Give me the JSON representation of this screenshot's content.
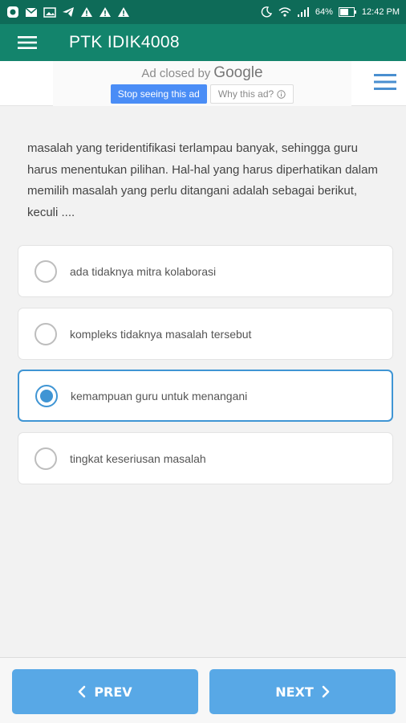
{
  "status_bar": {
    "battery": "64%",
    "time": "12:42 PM",
    "left_icons": [
      "app-icon",
      "mail-icon",
      "image-icon",
      "telegram-icon",
      "warning-icon",
      "warning-icon",
      "warning-icon"
    ],
    "right_icons": [
      "do-not-disturb-icon",
      "wifi-icon",
      "signal-icon",
      "battery-icon"
    ]
  },
  "app_bar": {
    "title": "PTK IDIK4008",
    "color": "#13846c"
  },
  "ad": {
    "closed_by": "Ad closed by",
    "google": "Google",
    "stop_button": "Stop seeing this ad",
    "why_button": "Why this ad?"
  },
  "question": {
    "text": "masalah yang teridentifikasi terlampau banyak, sehingga guru harus menentukan pilihan. Hal-hal yang harus diperhatikan dalam memilih masalah yang perlu ditangani adalah sebagai berikut, keculi ...."
  },
  "options": [
    {
      "label": "ada tidaknya mitra kolaborasi",
      "selected": false
    },
    {
      "label": "kompleks tidaknya masalah tersebut",
      "selected": false
    },
    {
      "label": "kemampuan guru untuk menangani",
      "selected": true
    },
    {
      "label": "tingkat keseriusan masalah",
      "selected": false
    }
  ],
  "nav": {
    "prev_label": "PREV",
    "next_label": "NEXT",
    "accent": "#58a8e6"
  }
}
